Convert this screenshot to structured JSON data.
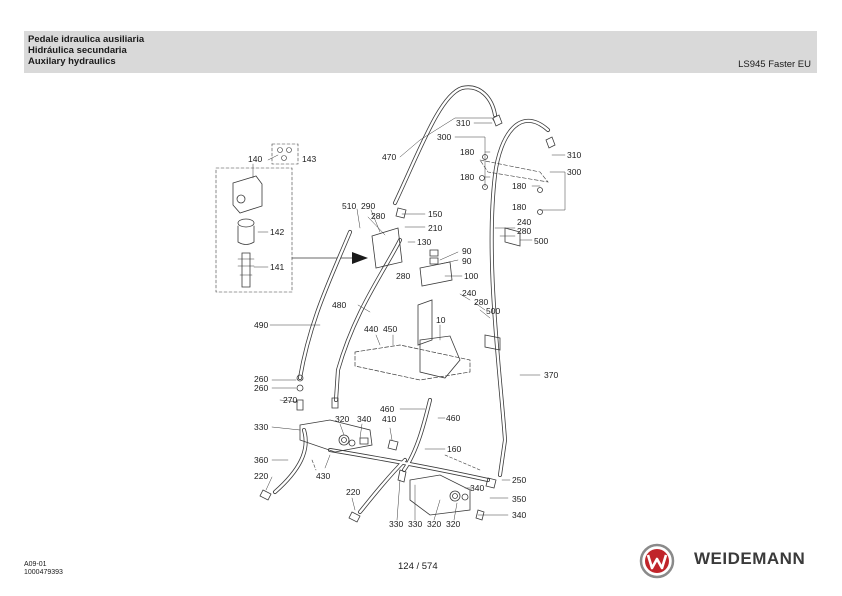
{
  "header": {
    "title_it": "Pedale idraulica ausiliaria",
    "title_es": "Hidráulica secundaria",
    "title_en": "Auxilary hydraulics",
    "model": "LS945 Faster EU"
  },
  "callouts": [
    "140",
    "143",
    "142",
    "141",
    "510",
    "290",
    "280",
    "150",
    "210",
    "130",
    "90",
    "90",
    "280",
    "100",
    "470",
    "310",
    "300",
    "180",
    "180",
    "310",
    "300",
    "180",
    "180",
    "240",
    "280",
    "500",
    "240",
    "280",
    "500",
    "480",
    "10",
    "490",
    "440",
    "450",
    "370",
    "260",
    "260",
    "270",
    "460",
    "460",
    "330",
    "320",
    "340",
    "410",
    "160",
    "360",
    "430",
    "220",
    "250",
    "220",
    "340",
    "350",
    "340",
    "330",
    "330",
    "320",
    "320"
  ],
  "footer": {
    "doc_code": "A09-01",
    "doc_number": "1000479393",
    "page": "124 / 574",
    "brand": "WEIDEMANN"
  },
  "colors": {
    "header_bg": "#d9d9d9",
    "logo_red": "#c0242a",
    "line": "#3a3a3a"
  },
  "icons": {
    "logo": "weidemann-w-logo"
  }
}
